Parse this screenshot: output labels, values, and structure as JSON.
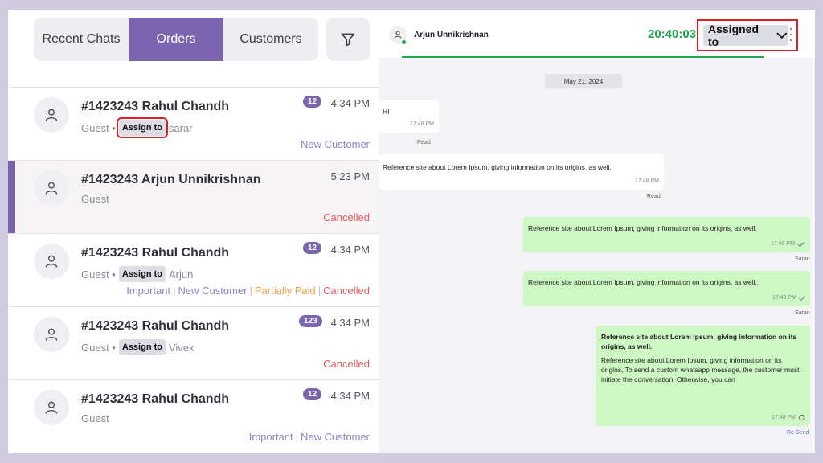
{
  "tabs": {
    "recent": "Recent Chats",
    "orders": "Orders",
    "customers": "Customers"
  },
  "icons": {
    "filter": "filter-icon",
    "avatar": "user-icon",
    "more": "kebab-icon",
    "dropdown": "chevron-down-icon",
    "read_tick": "check-icon",
    "resend": "refresh-icon"
  },
  "colors": {
    "accent": "#7a65ae",
    "online": "#1fa74f",
    "cancelled": "#e85a5a",
    "outgoing_bubble": "#cdf7c3",
    "highlight_box": "#e02020"
  },
  "chats": [
    {
      "title": "#1423243 Rahul Chandh",
      "sub": "Guest •",
      "assign": "Assign to",
      "assignee": "sarar",
      "badge": "12",
      "time": "4:34 PM",
      "tags": [
        "New Customer"
      ]
    },
    {
      "title": "#1423243 Arjun Unnikrishnan",
      "sub": "Guest",
      "time": "5:23 PM",
      "tags": [
        "Cancelled"
      ]
    },
    {
      "title": "#1423243 Rahul Chandh",
      "sub": "Guest •",
      "assign": "Assign to",
      "assignee": "Arjun",
      "badge": "12",
      "time": "4:34 PM",
      "tags": [
        "Important",
        "New Customer",
        "Partially Paid",
        "Cancelled"
      ]
    },
    {
      "title": "#1423243 Rahul Chandh",
      "sub": "Guest •",
      "assign": "Assign to",
      "assignee": "Vivek",
      "badge": "123",
      "time": "4:34 PM",
      "tags": [
        "Cancelled"
      ]
    },
    {
      "title": "#1423243 Rahul Chandh",
      "sub": "Guest",
      "badge": "12",
      "time": "4:34 PM",
      "tags": [
        "Important",
        "New Customer"
      ]
    }
  ],
  "conversation": {
    "contact_name": "Arjun Unnikrishnan",
    "timer": "20:40:03",
    "assigned_label": "Assigned to",
    "date": "May 21, 2024",
    "messages": [
      {
        "text": "HI",
        "time": "17:48 PM",
        "status": "Read"
      },
      {
        "text": "Reference site about Lorem Ipsum, giving information on its origins, as well.",
        "time": "17:48 PM",
        "status": "Read"
      },
      {
        "text": "Reference site about Lorem Ipsum, giving information on its origins, as well.",
        "time": "17:48 PM",
        "status": "Saran"
      },
      {
        "text": "Reference site about Lorem Ipsum, giving information on its origins, as well.",
        "time": "17:48 PM",
        "status": "Saran"
      },
      {
        "bold": "Reference site about Lorem Ipsum, giving information on its origins, as well.",
        "text": "Reference site about Lorem Ipsum, giving information on its origins, To send a custom whatsapp message, the customer must initiate the conversation. Otherwise, you can",
        "time": "17:48 PM",
        "status": "Re Send"
      }
    ]
  }
}
